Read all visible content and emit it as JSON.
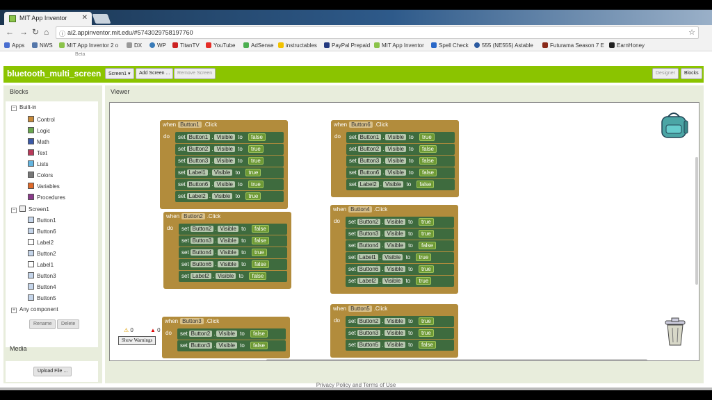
{
  "browser": {
    "tab_title": "MIT App Inventor",
    "url": "ai2.appinventor.mit.edu/#5743029758197760",
    "bookmarks": [
      "Apps",
      "NWS",
      "MIT App Inventor 2 o",
      "DX",
      "WP",
      "TitanTV",
      "YouTube",
      "AdSense",
      "instructables",
      "PayPal Prepaid",
      "MIT App Inventor",
      "Spell Check",
      "555 (NE555) Astable",
      "Futurama Season 7 E",
      "EarnHoney"
    ]
  },
  "app": {
    "beta_label": "Beta",
    "project_name": "bluetooth_multi_screen",
    "screen_dropdown": "Screen1 ▾",
    "add_screen": "Add Screen ...",
    "remove_screen": "Remove Screen",
    "designer": "Designer",
    "blocks": "Blocks"
  },
  "blocks_panel": {
    "title": "Blocks",
    "builtin": "Built-in",
    "builtins": [
      "Control",
      "Logic",
      "Math",
      "Text",
      "Lists",
      "Colors",
      "Variables",
      "Procedures"
    ],
    "screen": "Screen1",
    "components": [
      "Button1",
      "Button6",
      "Label2",
      "Button2",
      "Label1",
      "Button3",
      "Button4",
      "Button5"
    ],
    "any_component": "Any component",
    "rename": "Rename",
    "delete": "Delete"
  },
  "media": {
    "title": "Media",
    "upload": "Upload File ..."
  },
  "viewer": {
    "title": "Viewer",
    "warnings_count": "0",
    "errors_count": "0",
    "show_warnings": "Show Warnings",
    "blocks": [
      {
        "event": "Button1",
        "rows": [
          [
            "Button1",
            "Visible",
            "false"
          ],
          [
            "Button2",
            "Visible",
            "true"
          ],
          [
            "Button3",
            "Visible",
            "true"
          ],
          [
            "Label1",
            "Visible",
            "true"
          ],
          [
            "Button6",
            "Visible",
            "true"
          ],
          [
            "Label2",
            "Visible",
            "true"
          ]
        ]
      },
      {
        "event": "Button2",
        "rows": [
          [
            "Button2",
            "Visible",
            "false"
          ],
          [
            "Button3",
            "Visible",
            "false"
          ],
          [
            "Button4",
            "Visible",
            "true"
          ],
          [
            "Button6",
            "Visible",
            "false"
          ],
          [
            "Label2",
            "Visible",
            "false"
          ]
        ]
      },
      {
        "event": "Button3",
        "rows": [
          [
            "Button2",
            "Visible",
            "false"
          ],
          [
            "Button3",
            "Visible",
            "false"
          ]
        ]
      },
      {
        "event": "Button6",
        "rows": [
          [
            "Button1",
            "Visible",
            "true"
          ],
          [
            "Button2",
            "Visible",
            "false"
          ],
          [
            "Button3",
            "Visible",
            "false"
          ],
          [
            "Button6",
            "Visible",
            "false"
          ],
          [
            "Label2",
            "Visible",
            "false"
          ]
        ]
      },
      {
        "event": "Button4",
        "rows": [
          [
            "Button2",
            "Visible",
            "true"
          ],
          [
            "Button3",
            "Visible",
            "true"
          ],
          [
            "Button4",
            "Visible",
            "false"
          ],
          [
            "Label1",
            "Visible",
            "true"
          ],
          [
            "Button6",
            "Visible",
            "true"
          ],
          [
            "Label2",
            "Visible",
            "true"
          ]
        ]
      },
      {
        "event": "Button5",
        "rows": [
          [
            "Button2",
            "Visible",
            "true"
          ],
          [
            "Button3",
            "Visible",
            "true"
          ],
          [
            "Button5",
            "Visible",
            "false"
          ]
        ]
      }
    ]
  },
  "footer": "Privacy Policy and Terms of Use"
}
